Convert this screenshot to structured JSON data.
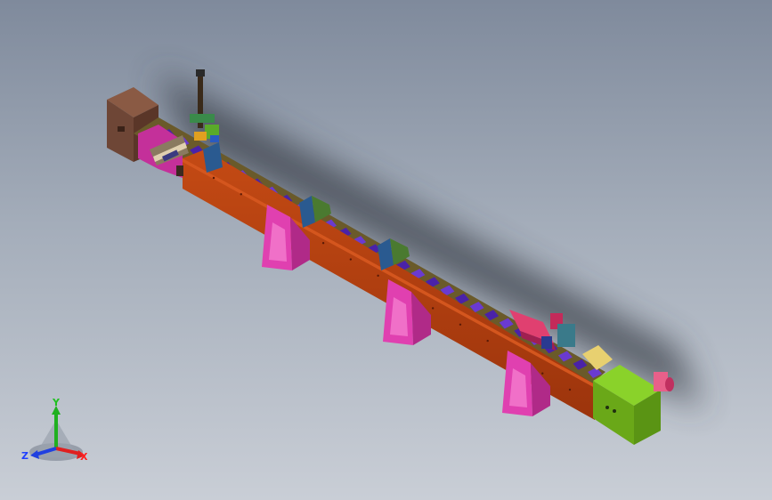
{
  "viewport": {
    "colors": {
      "background_top": "#7f8a9c",
      "background_bottom": "#c9ced6",
      "beam": "#b8400f",
      "beam_top": "#6a5a2a",
      "rollers": "#5a2fbf",
      "supports": "#e040b0",
      "left_cabinet": "#6e4636",
      "right_cabinet": "#7cc11e",
      "motor": "#e03070"
    }
  },
  "triad": {
    "x_label": "X",
    "y_label": "Y",
    "z_label": "Z",
    "colors": {
      "x": "#e02020",
      "y": "#20b020",
      "z": "#2040e0"
    }
  }
}
